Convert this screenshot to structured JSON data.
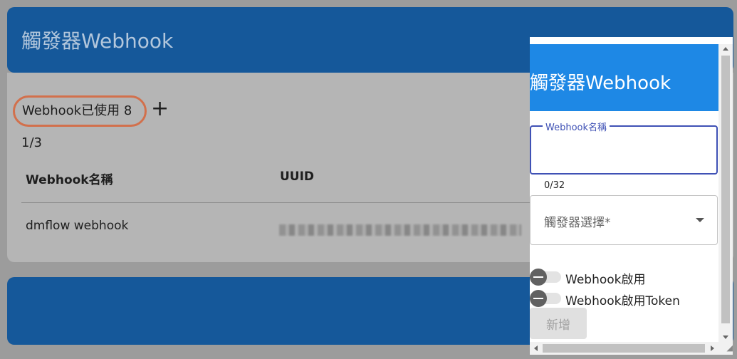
{
  "page": {
    "title": "觸發器Webhook",
    "usage_label": "Webhook已使用 8",
    "add_icon": "+",
    "page_count": "1/3",
    "table": {
      "headers": [
        "Webhook名稱",
        "UUID"
      ],
      "rows": [
        {
          "name": "dmflow webhook",
          "uuid": ""
        }
      ]
    }
  },
  "modal": {
    "title": "觸發器Webhook",
    "name_field": {
      "label": "Webhook名稱",
      "value": "",
      "counter": "0/32"
    },
    "trigger_select": {
      "placeholder": "觸發器選擇*"
    },
    "switch_enable": {
      "label": "Webhook啟用",
      "checked": false
    },
    "switch_token": {
      "label": "Webhook啟用Token",
      "checked": false
    },
    "add_button": "新增"
  },
  "colors": {
    "header_blue": "#1e88e5",
    "dim_blue": "#15589a",
    "focus_indigo": "#3f51b5",
    "highlight_orange": "#d2704c"
  }
}
